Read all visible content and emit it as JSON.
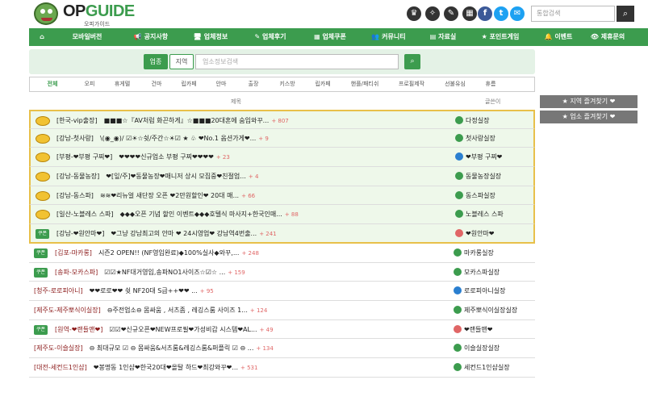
{
  "logo": {
    "title_a": "OP",
    "title_b": "GUIDE",
    "subtitle": "오피가이드"
  },
  "header": {
    "icons": [
      "crown-icon",
      "star-icon",
      "pen-icon",
      "book-icon",
      "facebook-icon",
      "twitter-icon",
      "mail-icon"
    ],
    "search_placeholder": "통합검색"
  },
  "nav": {
    "items": [
      {
        "label": "",
        "icon": "home-icon"
      },
      {
        "label": "모바일버전",
        "icon": ""
      },
      {
        "label": "📢 공지사항",
        "icon": "megaphone-icon"
      },
      {
        "label": "🖥 업체정보",
        "icon": "monitor-icon"
      },
      {
        "label": "✎ 업체후기",
        "icon": "pencil-icon"
      },
      {
        "label": "▦ 업체쿠폰",
        "icon": "coupon-icon"
      },
      {
        "label": "👥 커뮤니티",
        "icon": "users-icon"
      },
      {
        "label": "▤ 자료실",
        "icon": "folder-icon"
      },
      {
        "label": "★ 포인트게임",
        "icon": "game-icon"
      },
      {
        "label": "🔔 이벤트",
        "icon": "bell-icon"
      },
      {
        "label": "👁 제휴문의",
        "icon": "eye-icon"
      }
    ]
  },
  "search": {
    "btn_type": "업종",
    "btn_area": "지역",
    "placeholder": "업소정보검색"
  },
  "categories": [
    "전체",
    "오피",
    "휴게텔",
    "건마",
    "립카페",
    "안마",
    "출장",
    "키스방",
    "립카페",
    "핸플/패티쉬",
    "프로필제작",
    "선불유심",
    "휴름"
  ],
  "table": {
    "col_title": "제목",
    "col_writer": "글쓴이"
  },
  "side": {
    "btn_area": "★ 지역 즐겨찾기 ❤",
    "btn_biz": "★ 업소 즐겨찾기 ❤"
  },
  "rows": [
    {
      "vip": true,
      "tag": "",
      "cat": "[한국-vip출장]",
      "text": "■■■☆『AV처럼 화끈하게』☆■■■20대혼에 숨입와꾸...",
      "comments": "+ 807",
      "writer": "다정실장",
      "wcolor": "#3c9c4e"
    },
    {
      "vip": true,
      "tag": "",
      "cat": "[강남-첫사랑]",
      "text": "\\(◉_◉)/ ☑☀☆쉿/주간☆☀☑ ★ ♧ ❤No.1 옵션가게❤...",
      "comments": "+ 9",
      "writer": "첫사랑실장",
      "wcolor": "#3c9c4e"
    },
    {
      "vip": true,
      "tag": "",
      "cat": "[부평-❤부평 구찌❤]",
      "text": "❤❤❤❤신규업소 부평 구찌❤❤❤❤",
      "comments": "+ 23",
      "writer": "❤부평 구찌❤",
      "wcolor": "#2a7fd0"
    },
    {
      "vip": true,
      "tag": "",
      "cat": "[강남-동물농장]",
      "text": "❤[잎/주]❤동물농장❤매니저 상시 모집중❤친절업...",
      "comments": "+ 4",
      "writer": "동물농장실장",
      "wcolor": "#3c9c4e"
    },
    {
      "vip": true,
      "tag": "",
      "cat": "[강남-동스파]",
      "text": "≋≋❤리뉴얼 새단장 오픈 ❤2만원할인❤ 20대 매...",
      "comments": "+ 66",
      "writer": "동스파실장",
      "wcolor": "#3c9c4e"
    },
    {
      "vip": true,
      "tag": "",
      "cat": "[일산-노블레스 스파]",
      "text": "◆◆◆오픈 기념 할인 이벤트◆◆◆호텔식 마사지+한국인매...",
      "comments": "+ 88",
      "writer": "노블레스 스파",
      "wcolor": "#3c9c4e"
    },
    {
      "vip": true,
      "tag": "쿠폰",
      "cat": "[강남-❤원안마❤]",
      "text": "❤그냥 강남최고의 안마 ❤ 24시영업❤ 강남역4번출...",
      "comments": "+ 241",
      "writer": "❤원안마❤",
      "wcolor": "#e06666"
    },
    {
      "vip": false,
      "tag": "쿠폰",
      "cat": "[김포-마카롱]",
      "text": "시즌2 OPEN!! (NF영입완료)◆100%실사◆와꾸,...",
      "comments": "+ 248",
      "writer": "마카롱실장",
      "wcolor": "#3c9c4e"
    },
    {
      "vip": false,
      "tag": "쿠폰",
      "cat": "[송파-모카스파]",
      "text": "☑☑★NF대거영입,송파NO1사이즈☆☑☆ ...",
      "comments": "+ 159",
      "writer": "모카스파실장",
      "wcolor": "#3c9c4e"
    },
    {
      "vip": false,
      "tag": "",
      "cat": "[청주-로로피아니]",
      "text": "❤❤로로❤❤ 쉿 NF20대 S급++❤❤ ...",
      "comments": "+ 95",
      "writer": "로로피아니실장",
      "wcolor": "#2a7fd0"
    },
    {
      "vip": false,
      "tag": "",
      "cat": "[제주도-제주뽀식이실장]",
      "text": "⊖주전업소⊖ 몸싸움 , 서츠좀 , 레깅스룸 사이즈 1...",
      "comments": "+ 124",
      "writer": "제주뽀식이실장실장",
      "wcolor": "#3c9c4e"
    },
    {
      "vip": false,
      "tag": "쿠폰",
      "cat": "[원역-❤랜들맨❤]",
      "text": "☑☑❤신규오픈❤NEW프로필❤가성비갑 시스템❤AL...",
      "comments": "+ 49",
      "writer": "❤랜들맨❤",
      "wcolor": "#e06666"
    },
    {
      "vip": false,
      "tag": "",
      "cat": "[제주도-이슬실장]",
      "text": "⊖ 최대규모 ☑ ⊖ 몸싸움&서츠룸&레깅스룸&퍼플릭 ☑ ⊖ ...",
      "comments": "+ 134",
      "writer": "이슬실장실장",
      "wcolor": "#3c9c4e"
    },
    {
      "vip": false,
      "tag": "",
      "cat": "[대전-세컨드1인샵]",
      "text": "❤봉명동 1인샵❤한국20대❤올탈 하드❤최강와꾸❤...",
      "comments": "+ 531",
      "writer": "세컨드1인샵실장",
      "wcolor": "#3c9c4e"
    }
  ]
}
